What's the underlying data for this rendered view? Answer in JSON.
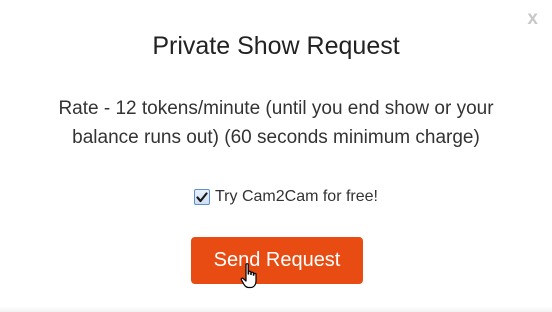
{
  "dialog": {
    "close_label": "x",
    "title": "Private Show Request",
    "rate_line_1": "Rate - 12 tokens/minute (until you end show or your",
    "rate_line_2": "balance runs out) (60 seconds minimum charge)",
    "cam2cam_label": "Try Cam2Cam for free!",
    "cam2cam_checked": true,
    "send_button_label": "Send Request"
  },
  "colors": {
    "accent": "#e84c12",
    "close_icon": "#c8c8c8",
    "checkbox_border": "#5a8fd0"
  },
  "icons": {
    "close": "close-icon",
    "checkmark": "checkmark-icon",
    "cursor": "hand-pointer-cursor-icon"
  }
}
